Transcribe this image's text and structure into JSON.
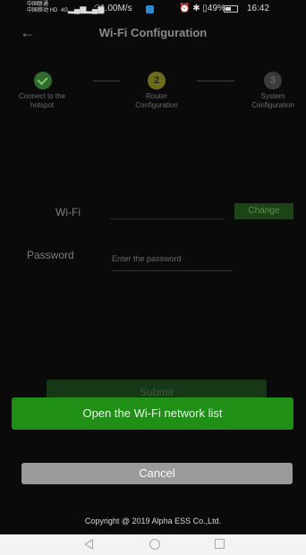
{
  "status_bar": {
    "carrier_1": "中国联通",
    "carrier_2": "中国移动 HD",
    "signal_1": "4G",
    "signal_2": "4G",
    "network_speed": "1.00M/s",
    "battery": "49%",
    "time": "16:42"
  },
  "header": {
    "title": "Wi-Fi Configuration"
  },
  "stepper": {
    "steps": [
      {
        "number": "1",
        "label_line1": "Connect to the",
        "label_line2": "hotspot",
        "state": "done"
      },
      {
        "number": "2",
        "label_line1": "Router",
        "label_line2": "Configuration",
        "state": "current"
      },
      {
        "number": "3",
        "label_line1": "System",
        "label_line2": "Configuration",
        "state": "pending"
      }
    ]
  },
  "form": {
    "wifi_label": "Wi-Fi",
    "wifi_value": "",
    "change_label": "Change",
    "password_label": "Password",
    "password_placeholder": "Enter the password",
    "submit_label": "Submit"
  },
  "action_sheet": {
    "open_list_label": "Open the Wi-Fi network list",
    "cancel_label": "Cancel"
  },
  "footer": {
    "copyright": "Copyright @ 2019 Alpha ESS Co.,Ltd."
  },
  "colors": {
    "accent_green": "#1f8f16",
    "cancel_gray": "#9a9a9a",
    "background": "#0a0a0a"
  }
}
